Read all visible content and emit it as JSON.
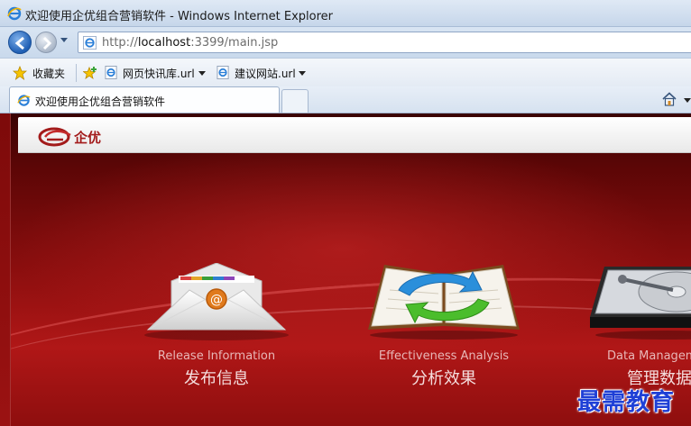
{
  "window": {
    "title": "欢迎使用企优组合营销软件 - Windows Internet Explorer"
  },
  "address": {
    "prefix": "http://",
    "host": "localhost",
    "rest": ":3399/main.jsp"
  },
  "favorites": {
    "label": "收藏夹",
    "items": [
      {
        "label": "网页快讯库.url"
      },
      {
        "label": "建议网站.url"
      }
    ]
  },
  "tabs": [
    {
      "label": "欢迎使用企优组合营销软件",
      "active": true
    }
  ],
  "app": {
    "logo_text": "企优",
    "features": [
      {
        "en": "Release Information",
        "cn": "发布信息",
        "icon": "envelope-icon"
      },
      {
        "en": "Effectiveness Analysis",
        "cn": "分析效果",
        "icon": "analysis-book-icon"
      },
      {
        "en": "Data Management",
        "cn": "管理数据",
        "icon": "hard-drive-icon"
      }
    ]
  },
  "watermark": "最需教育",
  "colors": {
    "brand_red": "#a31b1b",
    "background_red": "#8a0e0e",
    "watermark_blue": "#1e3fd6"
  }
}
